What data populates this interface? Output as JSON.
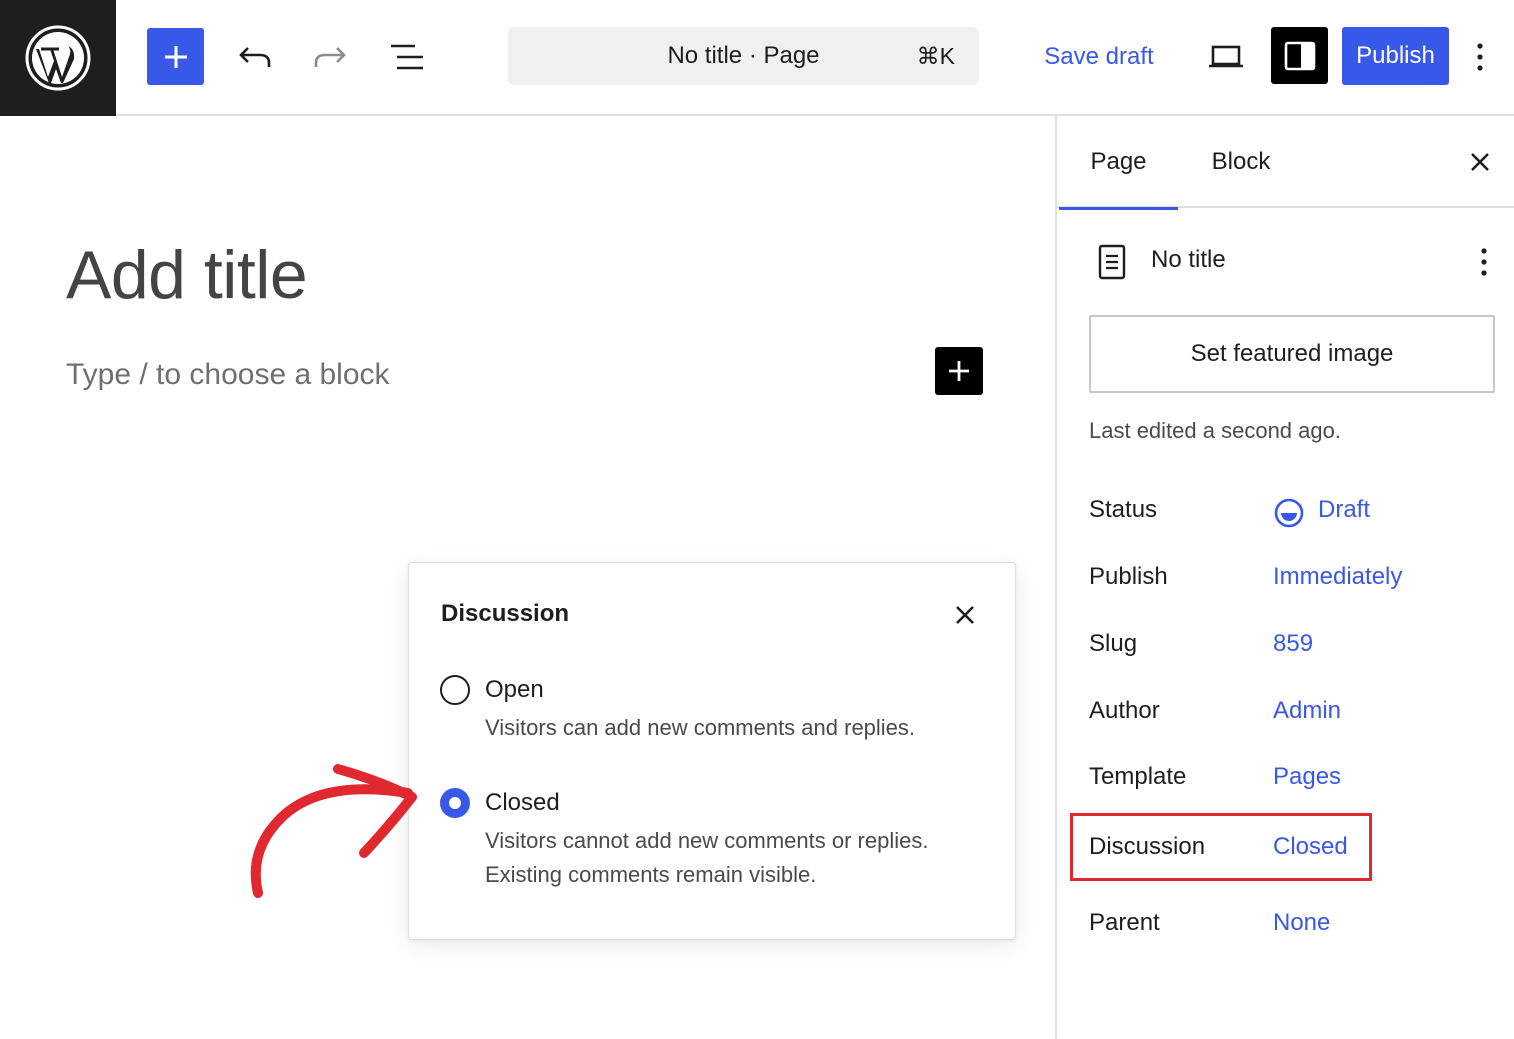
{
  "toolbar": {
    "logo_icon": "wordpress-logo-icon",
    "add_icon": "plus-icon",
    "undo_icon": "undo-icon",
    "redo_icon": "redo-icon",
    "list_view_icon": "list-view-icon",
    "command_title": "No title · Page",
    "command_shortcut": "⌘K",
    "save_draft_label": "Save draft",
    "preview_icon": "laptop-icon",
    "settings_icon": "sidebar-toggle-icon",
    "publish_label": "Publish",
    "more_icon": "more-vertical-icon"
  },
  "editor": {
    "title_placeholder": "Add title",
    "block_placeholder": "Type / to choose a block",
    "inline_add_icon": "plus-icon"
  },
  "discussion_popover": {
    "title": "Discussion",
    "close_icon": "close-icon",
    "options": [
      {
        "label": "Open",
        "description": [
          "Visitors can add new comments and replies."
        ],
        "selected": false
      },
      {
        "label": "Closed",
        "description": [
          "Visitors cannot add new comments or replies.",
          "Existing comments remain visible."
        ],
        "selected": true
      }
    ]
  },
  "sidebar": {
    "tabs": [
      {
        "label": "Page",
        "active": true
      },
      {
        "label": "Block",
        "active": false
      }
    ],
    "close_icon": "close-icon",
    "document": {
      "icon": "page-icon",
      "title": "No title",
      "more_icon": "more-vertical-icon"
    },
    "featured_image_label": "Set featured image",
    "last_edited": "Last edited a second ago.",
    "properties": [
      {
        "label": "Status",
        "value": "Draft",
        "icon": "draft-status-icon"
      },
      {
        "label": "Publish",
        "value": "Immediately"
      },
      {
        "label": "Slug",
        "value": "859"
      },
      {
        "label": "Author",
        "value": "Admin"
      },
      {
        "label": "Template",
        "value": "Pages"
      },
      {
        "label": "Discussion",
        "value": "Closed",
        "highlighted": true
      },
      {
        "label": "Parent",
        "value": "None"
      }
    ]
  },
  "colors": {
    "accent": "#3858e9",
    "annotation": "#e0282f",
    "dark": "#1e1e1e"
  }
}
